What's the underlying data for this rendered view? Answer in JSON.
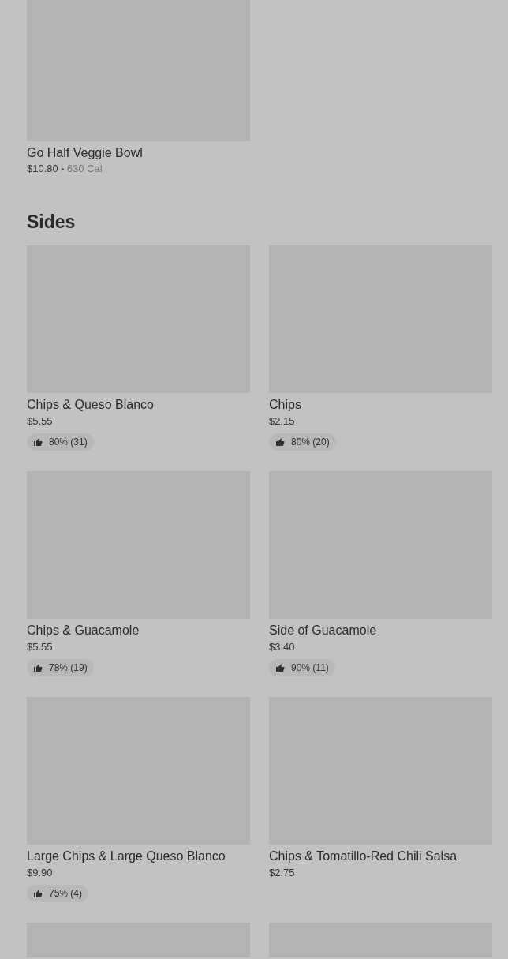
{
  "top_item": {
    "name": "Go Half Veggie Bowl",
    "price": "$10.80",
    "calories": "630 Cal"
  },
  "section": {
    "title": "Sides",
    "items": [
      {
        "kind": "item",
        "name": "Chips & Queso Blanco",
        "price": "$5.55",
        "rating": "80% (31)"
      },
      {
        "kind": "item",
        "name": "Chips",
        "price": "$2.15",
        "rating": "80% (20)"
      },
      {
        "kind": "item",
        "name": "Chips & Guacamole",
        "price": "$5.55",
        "rating": "78% (19)"
      },
      {
        "kind": "item",
        "name": "Side of Guacamole",
        "price": "$3.40",
        "rating": "90% (11)"
      },
      {
        "kind": "item",
        "name": "Large Chips & Large Queso Blanco",
        "price": "$9.90",
        "rating": "75% (4)"
      },
      {
        "kind": "item",
        "name": "Chips & Tomatillo-Red Chili Salsa",
        "price": "$2.75"
      },
      {
        "kind": "cut"
      },
      {
        "kind": "cut"
      }
    ]
  }
}
